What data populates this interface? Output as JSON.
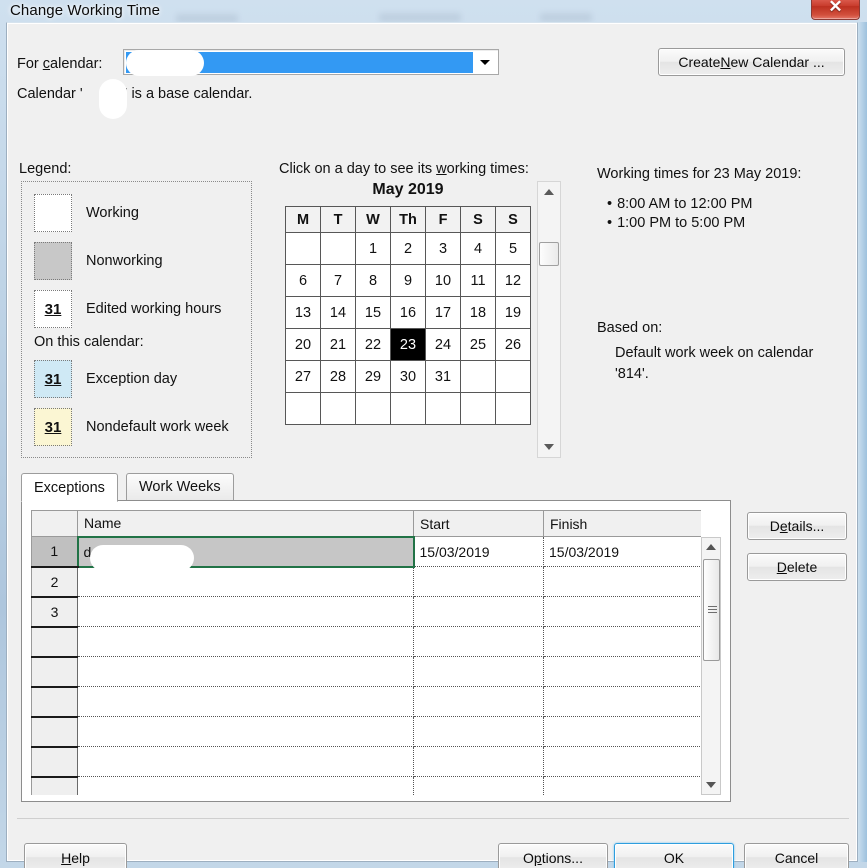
{
  "window": {
    "title": "Change Working Time",
    "close_icon": "close-icon",
    "close_glyph": "✕"
  },
  "top": {
    "for_calendar_label": "For calendar:",
    "combo_value": "",
    "combo_arrow_icon": "chevron-down-icon",
    "base_calendar_note": "Calendar '       ' is a base calendar.",
    "base_calendar_note_visible": "Calendar '814' is a base calendar.",
    "create_new_calendar_label": "Create New Calendar ..."
  },
  "legend": {
    "title": "Legend:",
    "on_this_calendar_title": "On this calendar:",
    "items": [
      {
        "label": "Working",
        "swatch": "working",
        "glyph": ""
      },
      {
        "label": "Nonworking",
        "swatch": "nonworking",
        "glyph": ""
      },
      {
        "label": "Edited working hours",
        "swatch": "edited",
        "glyph": "31"
      },
      {
        "label": "Exception day",
        "swatch": "exception",
        "glyph": "31"
      },
      {
        "label": "Nondefault work week",
        "swatch": "workweek",
        "glyph": "31"
      }
    ],
    "colors": {
      "working": "#ffffff",
      "nonworking": "#c8c8c8",
      "edited": "#ffffff",
      "exception": "#cfe9f5",
      "workweek": "#fbf6d3"
    }
  },
  "calendar": {
    "hint": "Click on a day to see its working times:",
    "month_title": "May 2019",
    "day_headers": [
      "M",
      "T",
      "W",
      "Th",
      "F",
      "S",
      "S"
    ],
    "weeks": [
      [
        "",
        "",
        "1",
        "2",
        "3",
        "4",
        "5"
      ],
      [
        "6",
        "7",
        "8",
        "9",
        "10",
        "11",
        "12"
      ],
      [
        "13",
        "14",
        "15",
        "16",
        "17",
        "18",
        "19"
      ],
      [
        "20",
        "21",
        "22",
        "23",
        "24",
        "25",
        "26"
      ],
      [
        "27",
        "28",
        "29",
        "30",
        "31",
        "",
        ""
      ],
      [
        "",
        "",
        "",
        "",
        "",
        "",
        ""
      ]
    ],
    "selected_day": "23",
    "scrollbar": {
      "up_icon": "scroll-up-arrow-icon",
      "down_icon": "scroll-down-arrow-icon"
    }
  },
  "working_times": {
    "title": "Working times for 23 May 2019:",
    "entries": [
      "8:00 AM to 12:00 PM",
      "1:00 PM to 5:00 PM"
    ],
    "based_on_label": "Based on:",
    "based_on_value": "Default work week on calendar '814'."
  },
  "tabs": [
    {
      "label": "Exceptions",
      "active": true
    },
    {
      "label": "Work Weeks",
      "active": false
    }
  ],
  "exceptions_table": {
    "columns": [
      "",
      "Name",
      "Start",
      "Finish"
    ],
    "rows": [
      {
        "num": "1",
        "name": "        day",
        "start": "15/03/2019",
        "finish": "15/03/2019",
        "selected": true
      },
      {
        "num": "2",
        "name": "",
        "start": "",
        "finish": "",
        "selected": false
      },
      {
        "num": "3",
        "name": "",
        "start": "",
        "finish": "",
        "selected": false
      },
      {
        "num": "",
        "name": "",
        "start": "",
        "finish": "",
        "selected": false
      },
      {
        "num": "",
        "name": "",
        "start": "",
        "finish": "",
        "selected": false
      },
      {
        "num": "",
        "name": "",
        "start": "",
        "finish": "",
        "selected": false
      },
      {
        "num": "",
        "name": "",
        "start": "",
        "finish": "",
        "selected": false
      },
      {
        "num": "",
        "name": "",
        "start": "",
        "finish": "",
        "selected": false
      },
      {
        "num": "",
        "name": "",
        "start": "",
        "finish": "",
        "selected": false
      }
    ],
    "selection_border_color": "#217346",
    "scrollbar": {
      "up_icon": "scroll-up-arrow-icon",
      "down_icon": "scroll-down-arrow-icon",
      "grip_icon": "grip-lines-icon"
    }
  },
  "side_buttons": {
    "details_label": "Details...",
    "delete_label": "Delete"
  },
  "footer": {
    "help_label": "Help",
    "options_label": "Options...",
    "ok_label": "OK",
    "cancel_label": "Cancel",
    "default_button": "OK",
    "default_button_accent": "#2e9ede"
  }
}
